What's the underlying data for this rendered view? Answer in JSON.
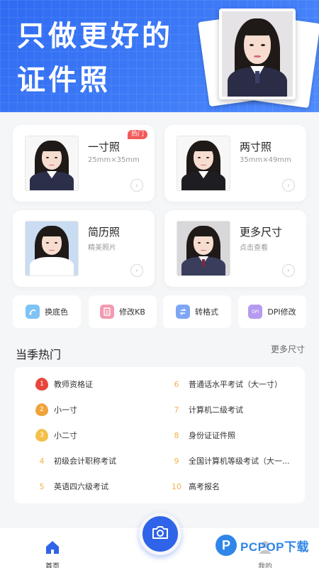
{
  "hero": {
    "line1": "只做更好的",
    "line2": "证件照"
  },
  "size_cards": [
    {
      "name": "一寸照",
      "sub": "25mm×35mm",
      "badge": "热门"
    },
    {
      "name": "两寸照",
      "sub": "35mm×49mm"
    },
    {
      "name": "简历照",
      "sub": "精美照片"
    },
    {
      "name": "更多尺寸",
      "sub": "点击查看"
    }
  ],
  "tools": [
    {
      "label": "换底色",
      "icon": "background-swap-icon",
      "color": "#7ec3f5"
    },
    {
      "label": "修改KB",
      "icon": "file-size-icon",
      "color": "#f39ab0"
    },
    {
      "label": "转格式",
      "icon": "convert-icon",
      "color": "#7fa6f5"
    },
    {
      "label": "DPI修改",
      "icon": "dpi-icon",
      "color": "#b59af0",
      "icon_text": "DPI"
    }
  ],
  "hot": {
    "title": "当季热门",
    "more": "更多尺寸",
    "items": [
      {
        "rank": "1",
        "text": "教师资格证"
      },
      {
        "rank": "2",
        "text": "小一寸"
      },
      {
        "rank": "3",
        "text": "小二寸"
      },
      {
        "rank": "4",
        "text": "初级会计职称考试"
      },
      {
        "rank": "5",
        "text": "英语四六级考试"
      },
      {
        "rank": "6",
        "text": "普通话水平考试（大一寸）"
      },
      {
        "rank": "7",
        "text": "计算机二级考试"
      },
      {
        "rank": "8",
        "text": "身份证证件照"
      },
      {
        "rank": "9",
        "text": "全国计算机等级考试（大一..."
      },
      {
        "rank": "10",
        "text": "高考报名"
      }
    ]
  },
  "nav": {
    "home": "首页",
    "mine": "我的"
  },
  "watermark": {
    "logo": "P",
    "text": "PCPOP下载"
  },
  "colors": {
    "primary": "#2f63e8",
    "hot_badge": "#f25a5a",
    "rank_top": "#e8453c",
    "rank_mid": "#f0a33a",
    "rank_low": "#f3c14a"
  }
}
